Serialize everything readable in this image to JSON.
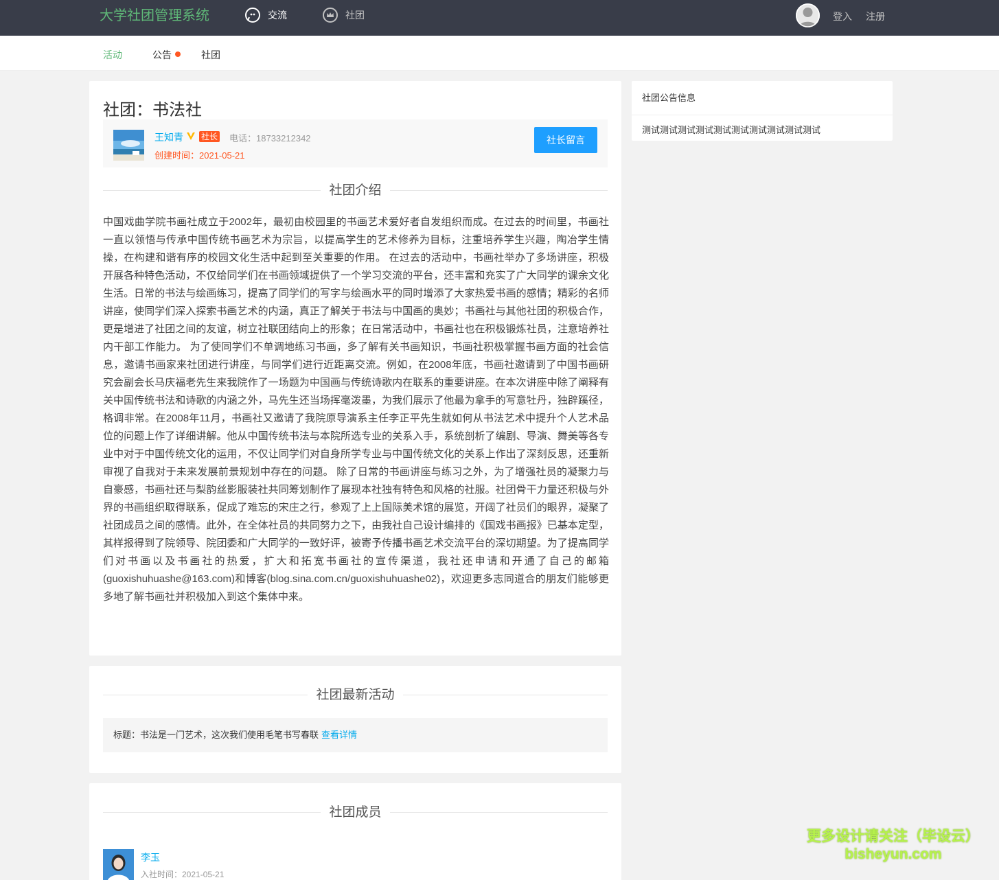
{
  "header": {
    "logo": "大学社团管理系统",
    "nav": [
      {
        "label": "交流",
        "icon": "chat-icon"
      },
      {
        "label": "社团",
        "icon": "crown-icon"
      }
    ],
    "login": "登入",
    "register": "注册"
  },
  "subnav": {
    "items": [
      {
        "label": "活动",
        "active": true
      },
      {
        "label": "公告",
        "badge_dot": true
      },
      {
        "label": "社团"
      }
    ]
  },
  "club": {
    "title": "社团：书法社",
    "leader": {
      "name": "王知青",
      "role": "社长",
      "phone": "电话：18733212342",
      "created": "创建时间：2021-05-21"
    },
    "message_button": "社长留言",
    "intro_title": "社团介绍",
    "intro": "中国戏曲学院书画社成立于2002年，最初由校园里的书画艺术爱好者自发组织而成。在过去的时间里，书画社一直以领悟与传承中国传统书画艺术为宗旨，以提高学生的艺术修养为目标，注重培养学生兴趣，陶冶学生情操，在构建和谐有序的校园文化生活中起到至关重要的作用。 在过去的活动中，书画社举办了多场讲座，积极开展各种特色活动，不仅给同学们在书画领域提供了一个学习交流的平台，还丰富和充实了广大同学的课余文化生活。日常的书法与绘画练习，提高了同学们的写字与绘画水平的同时增添了大家热爱书画的感情；精彩的名师讲座，使同学们深入探索书画艺术的内涵，真正了解关于书法与中国画的奥妙；书画社与其他社团的积极合作，更是增进了社团之间的友谊，树立社联团结向上的形象；在日常活动中，书画社也在积极锻炼社员，注意培养社内干部工作能力。 为了使同学们不单调地练习书画，多了解有关书画知识，书画社积极掌握书画方面的社会信息，邀请书画家来社团进行讲座，与同学们进行近距离交流。例如，在2008年底，书画社邀请到了中国书画研究会副会长马庆福老先生来我院作了一场题为中国画与传统诗歌内在联系的重要讲座。在本次讲座中除了阐释有关中国传统书法和诗歌的内涵之外，马先生还当场挥毫泼墨，为我们展示了他最为拿手的写意牡丹，独辟蹊径，格调非常。在2008年11月，书画社又邀请了我院原导演系主任李正平先生就如何从书法艺术中提升个人艺术品位的问题上作了详细讲解。他从中国传统书法与本院所选专业的关系入手，系统剖析了编剧、导演、舞美等各专业中对于中国传统文化的运用，不仅让同学们对自身所学专业与中国传统文化的关系上作出了深刻反思，还重新审视了自我对于未来发展前景规划中存在的问题。 除了日常的书画讲座与练习之外，为了增强社员的凝聚力与自豪感，书画社还与梨韵丝影服装社共同筹划制作了展现本社独有特色和风格的社服。社团骨干力量还积极与外界的书画组织取得联系，促成了难忘的宋庄之行，参观了上上国际美术馆的展览，开阔了社员们的眼界，凝聚了社团成员之间的感情。此外，在全体社员的共同努力之下，由我社自己设计编排的《国戏书画报》已基本定型，其样报得到了院领导、院团委和广大同学的一致好评，被寄予传播书画艺术交流平台的深切期望。为了提高同学们对书画以及书画社的热爱，扩大和拓宽书画社的宣传渠道，我社还申请和开通了自己的邮箱(guoxishuhuashe@163.com)和博客(blog.sina.com.cn/guoxishuhuashe02)，欢迎更多志同道合的朋友们能够更多地了解书画社并积极加入到这个集体中来。"
  },
  "activities": {
    "title": "社团最新活动",
    "items": [
      {
        "text": "标题：书法是一门艺术，这次我们使用毛笔书写春联",
        "link": "查看详情"
      }
    ]
  },
  "members": {
    "title": "社团成员",
    "items": [
      {
        "name": "李玉",
        "join": "入社时间：2021-05-21"
      }
    ]
  },
  "notice": {
    "title": "社团公告信息",
    "content": "测试测试测试测试测试测试测试测试测试测试"
  },
  "watermark": {
    "line1": "更多设计请关注（毕设云）",
    "line2": "bisheyun.com"
  },
  "colors": {
    "topbar": "#393d49",
    "accent_green": "#5fb878",
    "link_blue": "#01aaed",
    "button_blue": "#1e9fff",
    "orange": "#ff5722"
  }
}
